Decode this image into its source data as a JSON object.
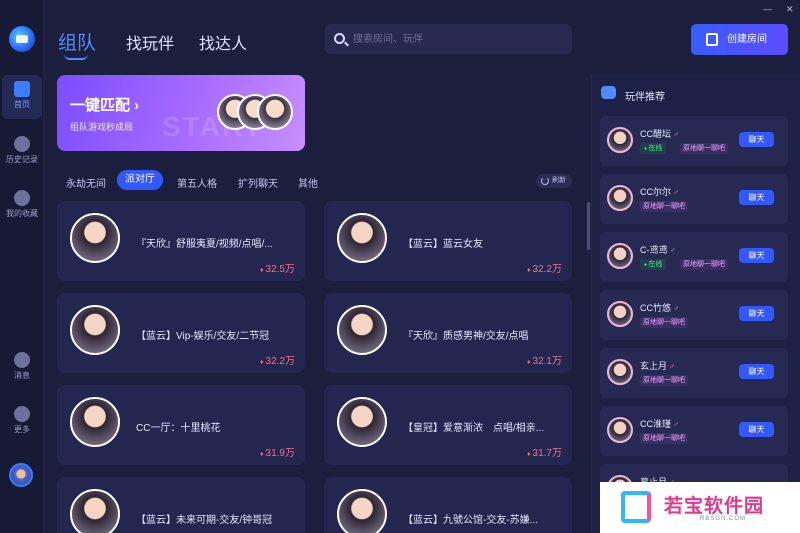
{
  "window": {
    "min": "—",
    "close": "✕"
  },
  "rail": {
    "items": [
      {
        "label": "首页",
        "icon": "home-icon"
      },
      {
        "label": "历史记录",
        "icon": "clock-icon"
      },
      {
        "label": "我的收藏",
        "icon": "star-icon"
      },
      {
        "label": "消息",
        "icon": "chat-icon"
      },
      {
        "label": "更多",
        "icon": "more-icon"
      }
    ]
  },
  "header": {
    "tabs": [
      "组队",
      "找玩伴",
      "找达人"
    ],
    "search_placeholder": "搜索房间、玩伴",
    "create_label": "创建房间"
  },
  "banner": {
    "title": "一键匹配 ›",
    "subtitle": "组队游戏秒成局",
    "watermark": "START"
  },
  "subtabs": {
    "items": [
      "永劫无间",
      "派对厅",
      "第五人格",
      "扩列聊天",
      "其他"
    ],
    "refresh": "刷新"
  },
  "rooms": [
    {
      "name": "『天欣』舒服夷夏/视频/点唱/...",
      "heat": "32.5万"
    },
    {
      "name": "【蓝云】蓝云女友",
      "heat": "32.2万"
    },
    {
      "name": "【蓝云】Vip-娱乐/交友/二节冠",
      "heat": "32.2万"
    },
    {
      "name": "『天欣』质感男神/交友/点唱",
      "heat": "32.1万"
    },
    {
      "name": "CC一厅：十里桃花",
      "heat": "31.9万"
    },
    {
      "name": "【皇冠】爱意渐浓　点唱/相亲...",
      "heat": "31.7万"
    },
    {
      "name": "【蓝云】未来可期-交友/钟哥冠",
      "heat": ""
    },
    {
      "name": "【蓝云】九號公馆-交友-苏嫌...",
      "heat": ""
    }
  ],
  "panel": {
    "title": "玩伴推荐",
    "chat_label": "聊天",
    "players": [
      {
        "name": "CC醋坛",
        "status": "在线",
        "tag": "原地聊一聊吧"
      },
      {
        "name": "CC尔尔",
        "status": "",
        "tag": "原地聊一聊吧"
      },
      {
        "name": "C-鸢鸢",
        "status": "在线",
        "tag": "原地聊一聊吧"
      },
      {
        "name": "CC竹悠",
        "status": "",
        "tag": "原地聊一聊吧"
      },
      {
        "name": "玄上月",
        "status": "",
        "tag": "原地聊一聊吧"
      },
      {
        "name": "CC淮瑾",
        "status": "",
        "tag": "原地聊一聊吧"
      },
      {
        "name": "暮止月",
        "status": "",
        "tag": ""
      }
    ]
  },
  "watermark": {
    "text": "若宝软件园",
    "sub": "RBSGN.COM"
  }
}
